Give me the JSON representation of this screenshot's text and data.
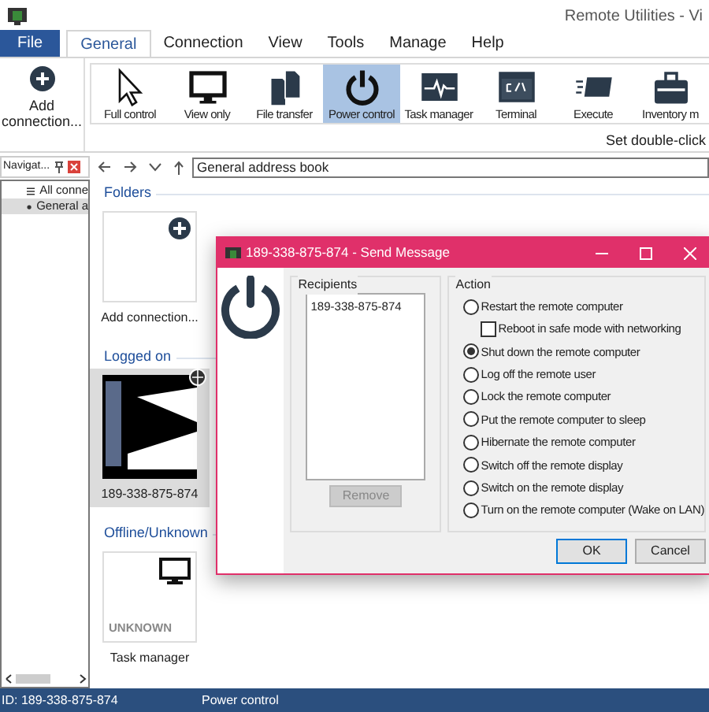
{
  "window": {
    "title": "Remote Utilities - Vi"
  },
  "ribbon_tabs": [
    {
      "label": "File",
      "kind": "file",
      "selected": false
    },
    {
      "label": "General",
      "kind": "tab",
      "selected": true
    },
    {
      "label": "Connection",
      "kind": "tab",
      "selected": false
    },
    {
      "label": "View",
      "kind": "tab",
      "selected": false
    },
    {
      "label": "Tools",
      "kind": "tab",
      "selected": false
    },
    {
      "label": "Manage",
      "kind": "tab",
      "selected": false
    },
    {
      "label": "Help",
      "kind": "tab",
      "selected": false
    }
  ],
  "add_connection": {
    "label": "Add connection..."
  },
  "modes": [
    {
      "label": "Full control",
      "selected": false
    },
    {
      "label": "View only",
      "selected": false
    },
    {
      "label": "File transfer",
      "selected": false
    },
    {
      "label": "Power control",
      "selected": true
    },
    {
      "label": "Task manager",
      "selected": false
    },
    {
      "label": "Terminal",
      "selected": false
    },
    {
      "label": "Execute",
      "selected": false
    },
    {
      "label": "Inventory m",
      "selected": false
    }
  ],
  "ribbon_hint": "Set double-click",
  "navigation": {
    "title": "Navigat...",
    "items": [
      {
        "label": "All conne",
        "selected": false
      },
      {
        "label": "General a",
        "selected": true
      }
    ]
  },
  "address": {
    "value": "General address book"
  },
  "groups": [
    {
      "title": "Folders",
      "cards": [
        {
          "kind": "add",
          "caption": "Add connection...",
          "selected": false
        }
      ]
    },
    {
      "title": "Logged on",
      "cards": [
        {
          "kind": "screen",
          "caption": "189-338-875-874",
          "selected": true
        }
      ]
    },
    {
      "title": "Offline/Unknown",
      "cards": [
        {
          "kind": "offline",
          "badge": "UNKNOWN",
          "caption": "Task manager",
          "selected": false
        }
      ]
    }
  ],
  "dialog": {
    "title": "189-338-875-874 - Send Message",
    "recipients": {
      "title": "Recipients",
      "items": [
        "189-338-875-874"
      ],
      "remove": {
        "label": "Remove",
        "disabled": true
      }
    },
    "action": {
      "title": "Action",
      "options": [
        {
          "kind": "radio",
          "label": "Restart the remote computer",
          "selected": false
        },
        {
          "kind": "checkbox",
          "label": "Reboot in safe mode with networking",
          "checked": false
        },
        {
          "kind": "radio",
          "label": "Shut down the remote computer",
          "selected": true
        },
        {
          "kind": "radio",
          "label": "Log off the remote user",
          "selected": false
        },
        {
          "kind": "radio",
          "label": "Lock the remote computer",
          "selected": false
        },
        {
          "kind": "radio",
          "label": "Put the remote computer to sleep",
          "selected": false
        },
        {
          "kind": "radio",
          "label": "Hibernate the remote computer",
          "selected": false
        },
        {
          "kind": "radio",
          "label": "Switch off the remote display",
          "selected": false
        },
        {
          "kind": "radio",
          "label": "Switch on the remote display",
          "selected": false
        },
        {
          "kind": "radio",
          "label": "Turn on the remote computer (Wake on LAN)",
          "selected": false
        }
      ]
    },
    "buttons": [
      "OK",
      "Cancel"
    ]
  },
  "status_bar": [
    "ID: 189-338-875-874",
    "Power control"
  ]
}
